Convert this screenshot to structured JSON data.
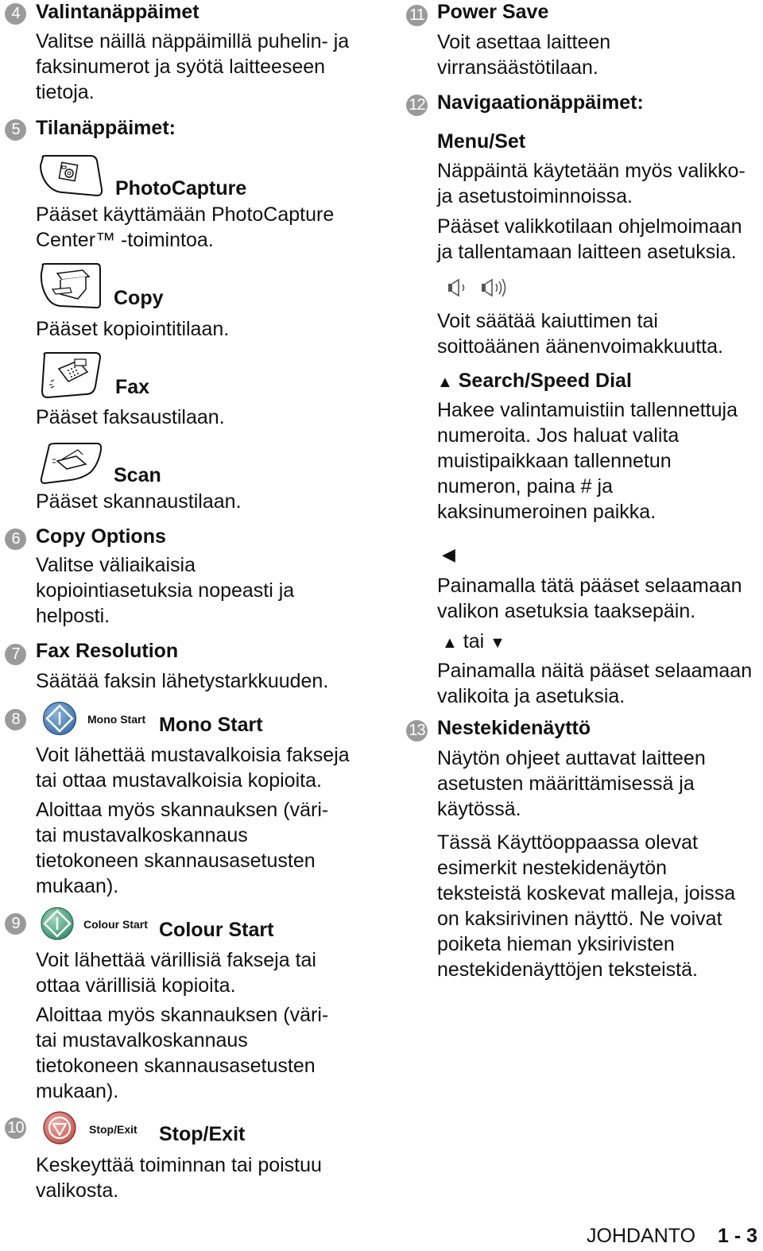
{
  "left_column": {
    "item4": {
      "number": "4",
      "title": "Valintanäppäimet",
      "text": "Valitse näillä näppäimillä puhelin- ja\nfaksinumerot ja syötä laitteeseen\ntietoja."
    },
    "item5": {
      "number": "5",
      "title": "Tilanäppäimet:",
      "keys": [
        {
          "icon": "photocapture-icon",
          "label": "PhotoCapture",
          "text": "Pääset käyttämään PhotoCapture\nCenter™ -toimintoa."
        },
        {
          "icon": "copy-icon",
          "label": "Copy",
          "text": "Pääset kopiointitilaan."
        },
        {
          "icon": "fax-icon",
          "label": "Fax",
          "text": "Pääset faksaustilaan."
        },
        {
          "icon": "scan-icon",
          "label": "Scan",
          "text": "Pääset skannaustilaan."
        }
      ]
    },
    "item6": {
      "number": "6",
      "title": "Copy Options",
      "text": "Valitse väliaikaisia\nkopiointiasetuksia nopeasti ja\nhelposti."
    },
    "item7": {
      "number": "7",
      "title": "Fax Resolution",
      "text": "Säätää faksin lähetystarkkuuden."
    },
    "item8": {
      "number": "8",
      "button_caption": "Mono Start",
      "title": "Mono Start",
      "text1": "Voit lähettää mustavalkoisia fakseja\ntai ottaa mustavalkoisia kopioita.",
      "text2": "Aloittaa myös skannauksen (väri-\ntai mustavalkoskannaus\ntietokoneen skannausasetusten\nmukaan).",
      "color": "#4a7fb8"
    },
    "item9": {
      "number": "9",
      "button_caption": "Colour Start",
      "title": "Colour Start",
      "text1": "Voit lähettää värillisiä fakseja tai\nottaa värillisiä kopioita.",
      "text2": "Aloittaa myös skannauksen (väri-\ntai mustavalkoskannaus\ntietokoneen skannausasetusten\nmukaan).",
      "color": "#3f9a78"
    },
    "item10": {
      "number": "10",
      "button_caption": "Stop/Exit",
      "title": "Stop/Exit",
      "text": "Keskeyttää toiminnan tai poistuu\nvalikosta.",
      "color": "#c9605c"
    }
  },
  "right_column": {
    "item11": {
      "number": "11",
      "title": "Power Save",
      "text": "Voit asettaa laitteen\nvirransäästötilaan."
    },
    "item12": {
      "number": "12",
      "title": "Navigaationäppäimet:",
      "menu_set": {
        "title": "Menu/Set",
        "text1": "Näppäintä käytetään myös valikko-\nja asetustoiminnoissa.",
        "text2": "Pääset valikkotilaan ohjelmoimaan\nja tallentamaan laitteen asetuksia."
      },
      "volume": {
        "icons": [
          "volume-low-icon",
          "volume-high-icon"
        ],
        "text": "Voit säätää kaiuttimen tai\nsoittoäänen äänenvoimakkuutta."
      },
      "search": {
        "symbol": "▲",
        "title": "Search/Speed Dial",
        "text": "Hakee valintamuistiin tallennettuja\nnumeroita. Jos haluat valita\nmuistipaikkaan tallennetun\nnumeron, paina # ja\nkaksinumeroinen paikka."
      },
      "back": {
        "symbol": "◀",
        "text": "Painamalla tätä pääset selaamaan\nvalikon asetuksia taaksepäin."
      },
      "updown": {
        "up": "▲",
        "word": "tai",
        "down": "▼",
        "text": "Painamalla näitä pääset selaamaan\nvalikoita ja asetuksia."
      }
    },
    "item13": {
      "number": "13",
      "title": "Nestekidenäyttö",
      "text1": "Näytön ohjeet auttavat laitteen\nasetusten määrittämisessä ja\nkäytössä.",
      "text2": "Tässä Käyttöoppaassa olevat\nesimerkit nestekidenäytön\nteksteistä koskevat malleja, joissa\non kaksirivinen näyttö. Ne voivat\npoiketa hieman yksirivisten\nnestekidenäyttöjen teksteistä."
    }
  },
  "footer": {
    "section": "JOHDANTO",
    "page": "1 - 3"
  }
}
